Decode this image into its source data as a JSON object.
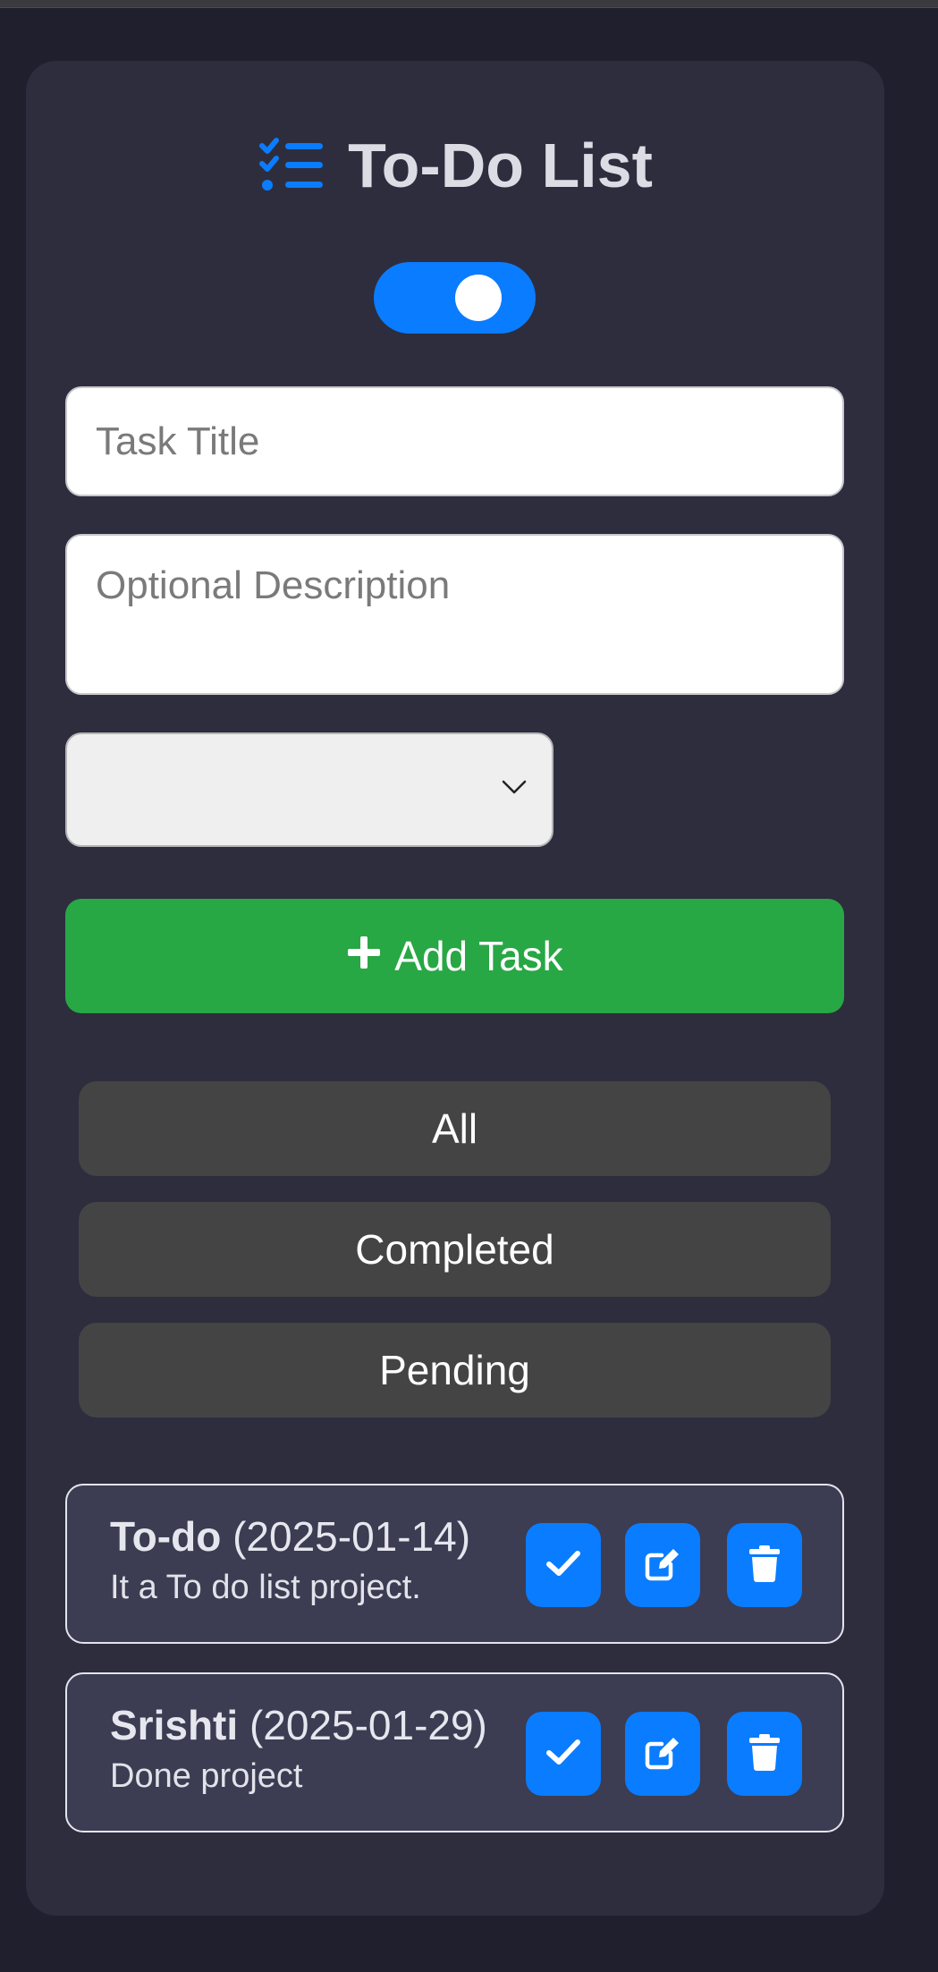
{
  "app": {
    "title": "To-Do List",
    "icon": "list-check-icon",
    "accent_color": "#0a7cff",
    "theme_toggle": {
      "on": true
    }
  },
  "form": {
    "title_placeholder": "Task Title",
    "description_placeholder": "Optional Description",
    "priority_select_value": "",
    "add_button_label": "Add Task",
    "add_button_icon": "plus-icon",
    "add_button_color": "#28a745"
  },
  "filters": [
    {
      "label": "All"
    },
    {
      "label": "Completed"
    },
    {
      "label": "Pending"
    }
  ],
  "tasks": [
    {
      "title": "To-do",
      "date": "(2025-01-14)",
      "description": "It a To do list project.",
      "actions": [
        "check-icon",
        "edit-icon",
        "trash-icon"
      ]
    },
    {
      "title": "Srishti",
      "date": "(2025-01-29)",
      "description": "Done project",
      "actions": [
        "check-icon",
        "edit-icon",
        "trash-icon"
      ]
    }
  ]
}
